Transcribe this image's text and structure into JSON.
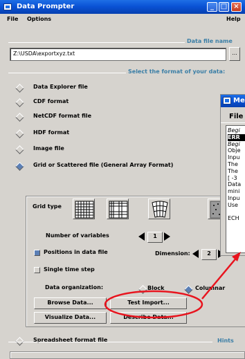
{
  "window": {
    "title": "Data Prompter"
  },
  "menubar": {
    "file": "File",
    "options": "Options",
    "help": "Help"
  },
  "datafile": {
    "section_label": "Data file name",
    "path": "Z:\\USDA\\exportxyz.txt",
    "browse": "..."
  },
  "format": {
    "section_label": "Select the format of your data:",
    "options": [
      {
        "label": "Data Explorer file",
        "selected": false
      },
      {
        "label": "CDF format",
        "selected": false
      },
      {
        "label": "NetCDF format file",
        "selected": false
      },
      {
        "label": "HDF format",
        "selected": false
      },
      {
        "label": "Image file",
        "selected": false
      },
      {
        "label": "Grid or Scattered file (General Array Format)",
        "selected": true
      }
    ],
    "spreadsheet": {
      "label": "Spreadsheet format file",
      "selected": false
    }
  },
  "grid": {
    "grid_type_label": "Grid type",
    "number_of_variables_label": "Number of variables",
    "number_of_variables": "1",
    "positions_label": "Positions in data file",
    "positions_checked": true,
    "dimension_label": "Dimension:",
    "dimension": "2",
    "single_time_step_label": "Single time step",
    "single_time_step_checked": false,
    "data_org_label": "Data organization:",
    "data_org_options": [
      "Block",
      "Columnar"
    ],
    "data_org_selected": "Columnar",
    "buttons": {
      "browse": "Browse Data...",
      "test_import": "Test Import...",
      "visualize": "Visualize Data...",
      "describe": "Describe Data..."
    }
  },
  "hints": {
    "label": "Hints"
  },
  "message_window": {
    "title": "Me",
    "menu_file": "File",
    "lines": [
      {
        "text": "Begi",
        "style": "italic"
      },
      {
        "text": "ERR",
        "style": "highlight"
      },
      {
        "text": "Begi",
        "style": "italic"
      },
      {
        "text": "Obje",
        "style": "normal"
      },
      {
        "text": "Inpu",
        "style": "normal"
      },
      {
        "text": "The",
        "style": "normal"
      },
      {
        "text": "The",
        "style": "normal"
      },
      {
        "text": "[ -3",
        "style": "normal"
      },
      {
        "text": "Data",
        "style": "normal"
      },
      {
        "text": "mini",
        "style": "normal"
      },
      {
        "text": "Inpu",
        "style": "normal"
      },
      {
        "text": "Use",
        "style": "normal"
      },
      {
        "text": "",
        "style": "normal"
      },
      {
        "text": "ECH",
        "style": "normal"
      }
    ]
  },
  "colors": {
    "titlebar": "#0a53d6",
    "window_bg": "#d6d3ce",
    "section_label": "#3a7ea6",
    "annotation": "#e8141e"
  }
}
